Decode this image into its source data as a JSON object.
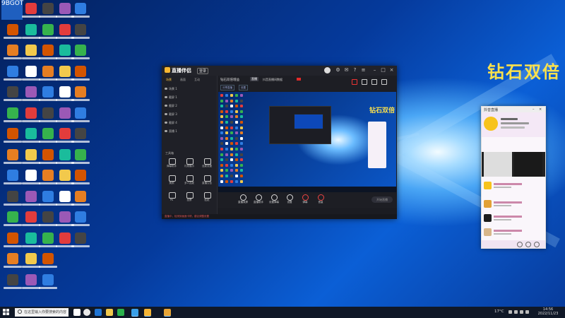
{
  "desktop": {
    "badge_text": "9BGOT",
    "overlay_text": "钻石双倍"
  },
  "app": {
    "logo_text": "直播伴侣",
    "badge": "登录",
    "tabs": [
      "场景",
      "画面",
      "互动"
    ],
    "scenes": [
      "场景 1",
      "截屏 1",
      "截屏 2",
      "截屏 3",
      "截屏 4",
      "直播 1"
    ],
    "tools_label": "工具箱",
    "tools": [
      "弹幕助手",
      "礼物展示",
      "连麦设置",
      "美颜",
      "多人连麦",
      "直播公告",
      "PK",
      "投票",
      "贴纸"
    ],
    "room_title": "钻石双倍增益",
    "room_tag": "直播",
    "room_id": "抖音直播间数据",
    "pills": [
      "分享直播",
      "设置"
    ],
    "preview_overlay": "钻石双倍",
    "controls": [
      "直播录屏",
      "直播助手",
      "设置弹幕",
      "设置",
      "弹幕",
      "音量"
    ],
    "start_label": "开始直播",
    "status_text": "直播中，检测到画面卡顿，建议调整设置"
  },
  "chat": {
    "title": "抖音直播"
  },
  "taskbar": {
    "search_placeholder": "在这里输入你要搜索的内容",
    "temperature": "17°C",
    "time": "14:56",
    "date": "2022/11/23"
  }
}
